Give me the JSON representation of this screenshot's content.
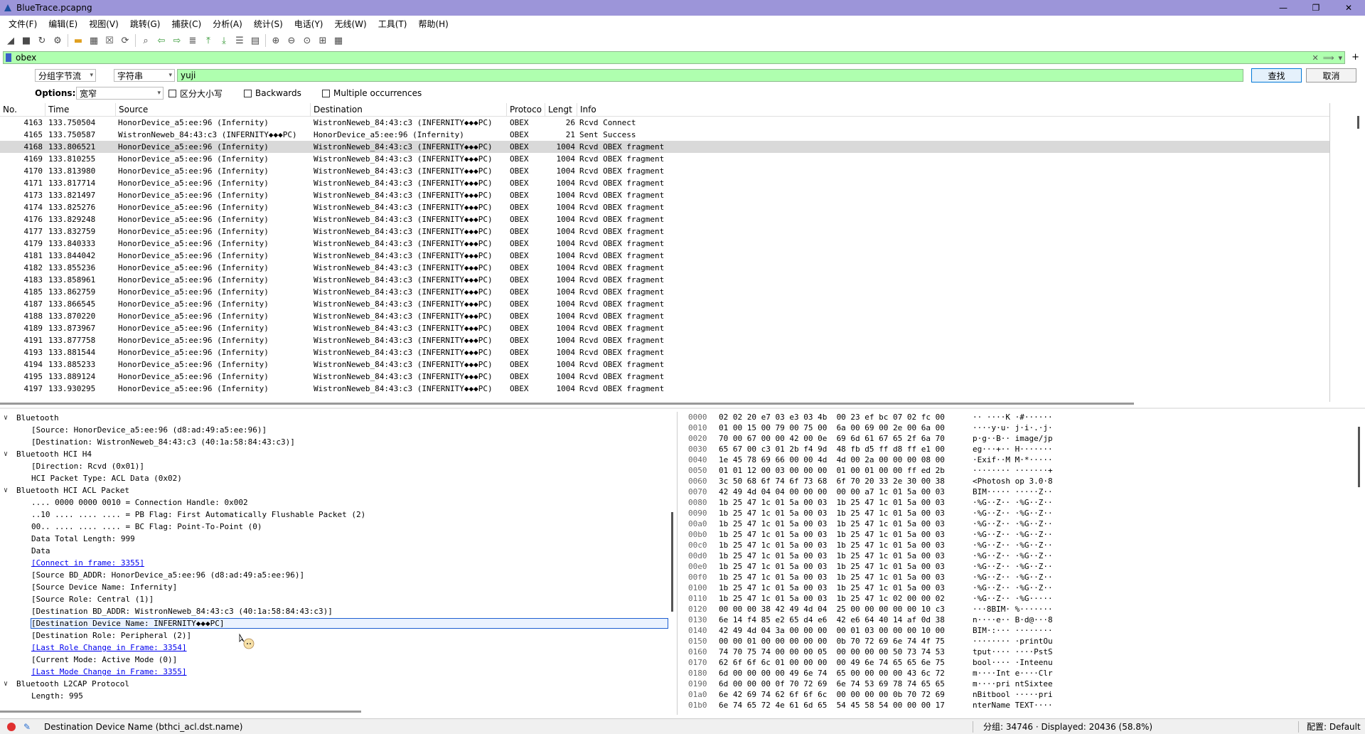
{
  "window": {
    "title": "BlueTrace.pcapng",
    "controls": [
      "—",
      "❐",
      "✕"
    ]
  },
  "menu": [
    "文件(F)",
    "编辑(E)",
    "视图(V)",
    "跳转(G)",
    "捕获(C)",
    "分析(A)",
    "统计(S)",
    "电话(Y)",
    "无线(W)",
    "工具(T)",
    "帮助(H)"
  ],
  "toolbar_icons": [
    "shark-fin-start-icon",
    "stop-icon",
    "restart-icon",
    "options-gear-icon",
    "open-folder-icon",
    "save-icon",
    "close-file-icon",
    "reload-icon",
    "find-icon",
    "go-back-icon",
    "go-forward-icon",
    "go-to-packet-icon",
    "first-packet-icon",
    "last-packet-icon",
    "autoscroll-icon",
    "colorize-icon",
    "zoom-in-icon",
    "zoom-out-icon",
    "zoom-normal-icon",
    "resize-columns-icon",
    "layout-icon"
  ],
  "filter": {
    "value": "obex",
    "clear_glyph": "✕",
    "apply_glyph": "⟹",
    "dropdown_glyph": "▾",
    "add_glyph": "+"
  },
  "find": {
    "scope": "分组字节流",
    "type": "字符串",
    "value": "yuji",
    "find_button": "查找",
    "cancel_button": "取消"
  },
  "options": {
    "label": "Options:",
    "charset": "宽窄",
    "case_sensitive": "区分大小写",
    "backwards": "Backwards",
    "multiple": "Multiple occurrences"
  },
  "packet_list": {
    "columns": [
      "No.",
      "Time",
      "Source",
      "Destination",
      "Protoco",
      "Lengt",
      "Info"
    ],
    "rows": [
      {
        "no": "4163",
        "time": "133.750504",
        "src": "HonorDevice_a5:ee:96 (Infernity)",
        "dst": "WistronNeweb_84:43:c3 (INFERNITY◆◆◆PC)",
        "proto": "OBEX",
        "len": "26",
        "info": "Rcvd Connect"
      },
      {
        "no": "4165",
        "time": "133.750587",
        "src": "WistronNeweb_84:43:c3 (INFERNITY◆◆◆PC)",
        "dst": "HonorDevice_a5:ee:96 (Infernity)",
        "proto": "OBEX",
        "len": "21",
        "info": "Sent Success"
      },
      {
        "no": "4168",
        "time": "133.806521",
        "src": "HonorDevice_a5:ee:96 (Infernity)",
        "dst": "WistronNeweb_84:43:c3 (INFERNITY◆◆◆PC)",
        "proto": "OBEX",
        "len": "1004",
        "info": "Rcvd OBEX fragment"
      },
      {
        "no": "4169",
        "time": "133.810255",
        "src": "HonorDevice_a5:ee:96 (Infernity)",
        "dst": "WistronNeweb_84:43:c3 (INFERNITY◆◆◆PC)",
        "proto": "OBEX",
        "len": "1004",
        "info": "Rcvd OBEX fragment"
      },
      {
        "no": "4170",
        "time": "133.813980",
        "src": "HonorDevice_a5:ee:96 (Infernity)",
        "dst": "WistronNeweb_84:43:c3 (INFERNITY◆◆◆PC)",
        "proto": "OBEX",
        "len": "1004",
        "info": "Rcvd OBEX fragment"
      },
      {
        "no": "4171",
        "time": "133.817714",
        "src": "HonorDevice_a5:ee:96 (Infernity)",
        "dst": "WistronNeweb_84:43:c3 (INFERNITY◆◆◆PC)",
        "proto": "OBEX",
        "len": "1004",
        "info": "Rcvd OBEX fragment"
      },
      {
        "no": "4173",
        "time": "133.821497",
        "src": "HonorDevice_a5:ee:96 (Infernity)",
        "dst": "WistronNeweb_84:43:c3 (INFERNITY◆◆◆PC)",
        "proto": "OBEX",
        "len": "1004",
        "info": "Rcvd OBEX fragment"
      },
      {
        "no": "4174",
        "time": "133.825276",
        "src": "HonorDevice_a5:ee:96 (Infernity)",
        "dst": "WistronNeweb_84:43:c3 (INFERNITY◆◆◆PC)",
        "proto": "OBEX",
        "len": "1004",
        "info": "Rcvd OBEX fragment"
      },
      {
        "no": "4176",
        "time": "133.829248",
        "src": "HonorDevice_a5:ee:96 (Infernity)",
        "dst": "WistronNeweb_84:43:c3 (INFERNITY◆◆◆PC)",
        "proto": "OBEX",
        "len": "1004",
        "info": "Rcvd OBEX fragment"
      },
      {
        "no": "4177",
        "time": "133.832759",
        "src": "HonorDevice_a5:ee:96 (Infernity)",
        "dst": "WistronNeweb_84:43:c3 (INFERNITY◆◆◆PC)",
        "proto": "OBEX",
        "len": "1004",
        "info": "Rcvd OBEX fragment"
      },
      {
        "no": "4179",
        "time": "133.840333",
        "src": "HonorDevice_a5:ee:96 (Infernity)",
        "dst": "WistronNeweb_84:43:c3 (INFERNITY◆◆◆PC)",
        "proto": "OBEX",
        "len": "1004",
        "info": "Rcvd OBEX fragment"
      },
      {
        "no": "4181",
        "time": "133.844042",
        "src": "HonorDevice_a5:ee:96 (Infernity)",
        "dst": "WistronNeweb_84:43:c3 (INFERNITY◆◆◆PC)",
        "proto": "OBEX",
        "len": "1004",
        "info": "Rcvd OBEX fragment"
      },
      {
        "no": "4182",
        "time": "133.855236",
        "src": "HonorDevice_a5:ee:96 (Infernity)",
        "dst": "WistronNeweb_84:43:c3 (INFERNITY◆◆◆PC)",
        "proto": "OBEX",
        "len": "1004",
        "info": "Rcvd OBEX fragment"
      },
      {
        "no": "4183",
        "time": "133.858961",
        "src": "HonorDevice_a5:ee:96 (Infernity)",
        "dst": "WistronNeweb_84:43:c3 (INFERNITY◆◆◆PC)",
        "proto": "OBEX",
        "len": "1004",
        "info": "Rcvd OBEX fragment"
      },
      {
        "no": "4185",
        "time": "133.862759",
        "src": "HonorDevice_a5:ee:96 (Infernity)",
        "dst": "WistronNeweb_84:43:c3 (INFERNITY◆◆◆PC)",
        "proto": "OBEX",
        "len": "1004",
        "info": "Rcvd OBEX fragment"
      },
      {
        "no": "4187",
        "time": "133.866545",
        "src": "HonorDevice_a5:ee:96 (Infernity)",
        "dst": "WistronNeweb_84:43:c3 (INFERNITY◆◆◆PC)",
        "proto": "OBEX",
        "len": "1004",
        "info": "Rcvd OBEX fragment"
      },
      {
        "no": "4188",
        "time": "133.870220",
        "src": "HonorDevice_a5:ee:96 (Infernity)",
        "dst": "WistronNeweb_84:43:c3 (INFERNITY◆◆◆PC)",
        "proto": "OBEX",
        "len": "1004",
        "info": "Rcvd OBEX fragment"
      },
      {
        "no": "4189",
        "time": "133.873967",
        "src": "HonorDevice_a5:ee:96 (Infernity)",
        "dst": "WistronNeweb_84:43:c3 (INFERNITY◆◆◆PC)",
        "proto": "OBEX",
        "len": "1004",
        "info": "Rcvd OBEX fragment"
      },
      {
        "no": "4191",
        "time": "133.877758",
        "src": "HonorDevice_a5:ee:96 (Infernity)",
        "dst": "WistronNeweb_84:43:c3 (INFERNITY◆◆◆PC)",
        "proto": "OBEX",
        "len": "1004",
        "info": "Rcvd OBEX fragment"
      },
      {
        "no": "4193",
        "time": "133.881544",
        "src": "HonorDevice_a5:ee:96 (Infernity)",
        "dst": "WistronNeweb_84:43:c3 (INFERNITY◆◆◆PC)",
        "proto": "OBEX",
        "len": "1004",
        "info": "Rcvd OBEX fragment"
      },
      {
        "no": "4194",
        "time": "133.885233",
        "src": "HonorDevice_a5:ee:96 (Infernity)",
        "dst": "WistronNeweb_84:43:c3 (INFERNITY◆◆◆PC)",
        "proto": "OBEX",
        "len": "1004",
        "info": "Rcvd OBEX fragment"
      },
      {
        "no": "4195",
        "time": "133.889124",
        "src": "HonorDevice_a5:ee:96 (Infernity)",
        "dst": "WistronNeweb_84:43:c3 (INFERNITY◆◆◆PC)",
        "proto": "OBEX",
        "len": "1004",
        "info": "Rcvd OBEX fragment"
      },
      {
        "no": "4197",
        "time": "133.930295",
        "src": "HonorDevice_a5:ee:96 (Infernity)",
        "dst": "WistronNeweb_84:43:c3 (INFERNITY◆◆◆PC)",
        "proto": "OBEX",
        "len": "1004",
        "info": "Rcvd OBEX fragment"
      }
    ],
    "selected_no": "4168"
  },
  "details": [
    {
      "level": 0,
      "tw": "v",
      "text": "Bluetooth"
    },
    {
      "level": 2,
      "text": "[Source: HonorDevice_a5:ee:96 (d8:ad:49:a5:ee:96)]"
    },
    {
      "level": 2,
      "text": "[Destination: WistronNeweb_84:43:c3 (40:1a:58:84:43:c3)]"
    },
    {
      "level": 0,
      "tw": "v",
      "text": "Bluetooth HCI H4"
    },
    {
      "level": 2,
      "text": "[Direction: Rcvd (0x01)]"
    },
    {
      "level": 2,
      "text": "HCI Packet Type: ACL Data (0x02)"
    },
    {
      "level": 0,
      "tw": "v",
      "text": "Bluetooth HCI ACL Packet"
    },
    {
      "level": 2,
      "text": ".... 0000 0000 0010 = Connection Handle: 0x002"
    },
    {
      "level": 2,
      "text": "..10 .... .... .... = PB Flag: First Automatically Flushable Packet (2)"
    },
    {
      "level": 2,
      "text": "00.. .... .... .... = BC Flag: Point-To-Point (0)"
    },
    {
      "level": 2,
      "text": "Data Total Length: 999"
    },
    {
      "level": 2,
      "text": "Data"
    },
    {
      "level": 2,
      "text": "[Connect in frame: 3355]",
      "link": true
    },
    {
      "level": 2,
      "text": "[Source BD_ADDR: HonorDevice_a5:ee:96 (d8:ad:49:a5:ee:96)]"
    },
    {
      "level": 2,
      "text": "[Source Device Name: Infernity]"
    },
    {
      "level": 2,
      "text": "[Source Role: Central (1)]"
    },
    {
      "level": 2,
      "text": "[Destination BD_ADDR: WistronNeweb_84:43:c3 (40:1a:58:84:43:c3)]"
    },
    {
      "level": 2,
      "text": "[Destination Device Name: INFERNITY◆◆◆PC]",
      "highlight": true
    },
    {
      "level": 2,
      "text": "[Destination Role: Peripheral (2)]"
    },
    {
      "level": 2,
      "text": "[Last Role Change in Frame: 3354]",
      "link": true
    },
    {
      "level": 2,
      "text": "[Current Mode: Active Mode (0)]"
    },
    {
      "level": 2,
      "text": "[Last Mode Change in Frame: 3355]",
      "link": true
    },
    {
      "level": 0,
      "tw": "v",
      "text": "Bluetooth L2CAP Protocol"
    },
    {
      "level": 2,
      "text": "Length: 995"
    }
  ],
  "bytes": [
    {
      "off": "0000",
      "hex": "02 02 20 e7 03 e3 03 4b  00 23 ef bc 07 02 fc 00",
      "asc": "·· ····K ·#······"
    },
    {
      "off": "0010",
      "hex": "01 00 15 00 79 00 75 00  6a 00 69 00 2e 00 6a 00",
      "asc": "····y·u· j·i·.·j·"
    },
    {
      "off": "0020",
      "hex": "70 00 67 00 00 42 00 0e  69 6d 61 67 65 2f 6a 70",
      "asc": "p·g··B·· image/jp"
    },
    {
      "off": "0030",
      "hex": "65 67 00 c3 01 2b f4 9d  48 fb d5 ff d8 ff e1 00",
      "asc": "eg···+·· H·······"
    },
    {
      "off": "0040",
      "hex": "1e 45 78 69 66 00 00 4d  4d 00 2a 00 00 00 08 00",
      "asc": "·Exif··M M·*·····"
    },
    {
      "off": "0050",
      "hex": "01 01 12 00 03 00 00 00  01 00 01 00 00 ff ed 2b",
      "asc": "········ ·······+"
    },
    {
      "off": "0060",
      "hex": "3c 50 68 6f 74 6f 73 68  6f 70 20 33 2e 30 00 38",
      "asc": "<Photosh op 3.0·8"
    },
    {
      "off": "0070",
      "hex": "42 49 4d 04 04 00 00 00  00 00 a7 1c 01 5a 00 03",
      "asc": "BIM····· ·····Z··"
    },
    {
      "off": "0080",
      "hex": "1b 25 47 1c 01 5a 00 03  1b 25 47 1c 01 5a 00 03",
      "asc": "·%G··Z·· ·%G··Z··"
    },
    {
      "off": "0090",
      "hex": "1b 25 47 1c 01 5a 00 03  1b 25 47 1c 01 5a 00 03",
      "asc": "·%G··Z·· ·%G··Z··"
    },
    {
      "off": "00a0",
      "hex": "1b 25 47 1c 01 5a 00 03  1b 25 47 1c 01 5a 00 03",
      "asc": "·%G··Z·· ·%G··Z··"
    },
    {
      "off": "00b0",
      "hex": "1b 25 47 1c 01 5a 00 03  1b 25 47 1c 01 5a 00 03",
      "asc": "·%G··Z·· ·%G··Z··"
    },
    {
      "off": "00c0",
      "hex": "1b 25 47 1c 01 5a 00 03  1b 25 47 1c 01 5a 00 03",
      "asc": "·%G··Z·· ·%G··Z··"
    },
    {
      "off": "00d0",
      "hex": "1b 25 47 1c 01 5a 00 03  1b 25 47 1c 01 5a 00 03",
      "asc": "·%G··Z·· ·%G··Z··"
    },
    {
      "off": "00e0",
      "hex": "1b 25 47 1c 01 5a 00 03  1b 25 47 1c 01 5a 00 03",
      "asc": "·%G··Z·· ·%G··Z··"
    },
    {
      "off": "00f0",
      "hex": "1b 25 47 1c 01 5a 00 03  1b 25 47 1c 01 5a 00 03",
      "asc": "·%G··Z·· ·%G··Z··"
    },
    {
      "off": "0100",
      "hex": "1b 25 47 1c 01 5a 00 03  1b 25 47 1c 01 5a 00 03",
      "asc": "·%G··Z·· ·%G··Z··"
    },
    {
      "off": "0110",
      "hex": "1b 25 47 1c 01 5a 00 03  1b 25 47 1c 02 00 00 02",
      "asc": "·%G··Z·· ·%G·····"
    },
    {
      "off": "0120",
      "hex": "00 00 00 38 42 49 4d 04  25 00 00 00 00 00 10 c3",
      "asc": "···8BIM· %·······"
    },
    {
      "off": "0130",
      "hex": "6e 14 f4 85 e2 65 d4 e6  42 e6 64 40 14 af 0d 38",
      "asc": "n····e·· B·d@···8"
    },
    {
      "off": "0140",
      "hex": "42 49 4d 04 3a 00 00 00  00 01 03 00 00 00 10 00",
      "asc": "BIM·:··· ········"
    },
    {
      "off": "0150",
      "hex": "00 00 01 00 00 00 00 00  0b 70 72 69 6e 74 4f 75",
      "asc": "········ ·printOu"
    },
    {
      "off": "0160",
      "hex": "74 70 75 74 00 00 00 05  00 00 00 00 50 73 74 53",
      "asc": "tput···· ····PstS"
    },
    {
      "off": "0170",
      "hex": "62 6f 6f 6c 01 00 00 00  00 49 6e 74 65 65 6e 75",
      "asc": "bool···· ·Inteenu"
    },
    {
      "off": "0180",
      "hex": "6d 00 00 00 00 49 6e 74  65 00 00 00 00 43 6c 72",
      "asc": "m····Int e····Clr"
    },
    {
      "off": "0190",
      "hex": "6d 00 00 00 0f 70 72 69  6e 74 53 69 78 74 65 65",
      "asc": "m····pri ntSixtee"
    },
    {
      "off": "01a0",
      "hex": "6e 42 69 74 62 6f 6f 6c  00 00 00 00 0b 70 72 69",
      "asc": "nBitbool ·····pri"
    },
    {
      "off": "01b0",
      "hex": "6e 74 65 72 4e 61 6d 65  54 45 58 54 00 00 00 17",
      "asc": "nterName TEXT····"
    }
  ],
  "status": {
    "field": "Destination Device Name (bthci_acl.dst.name)",
    "counts": "分组: 34746 · Displayed: 20436 (58.8%)",
    "profile": "配置: Default"
  },
  "colors": {
    "titlebar": "#9c95d9",
    "filter_ok": "#afffaf",
    "selected_row": "#d9d9d9",
    "link": "#0000ee"
  }
}
